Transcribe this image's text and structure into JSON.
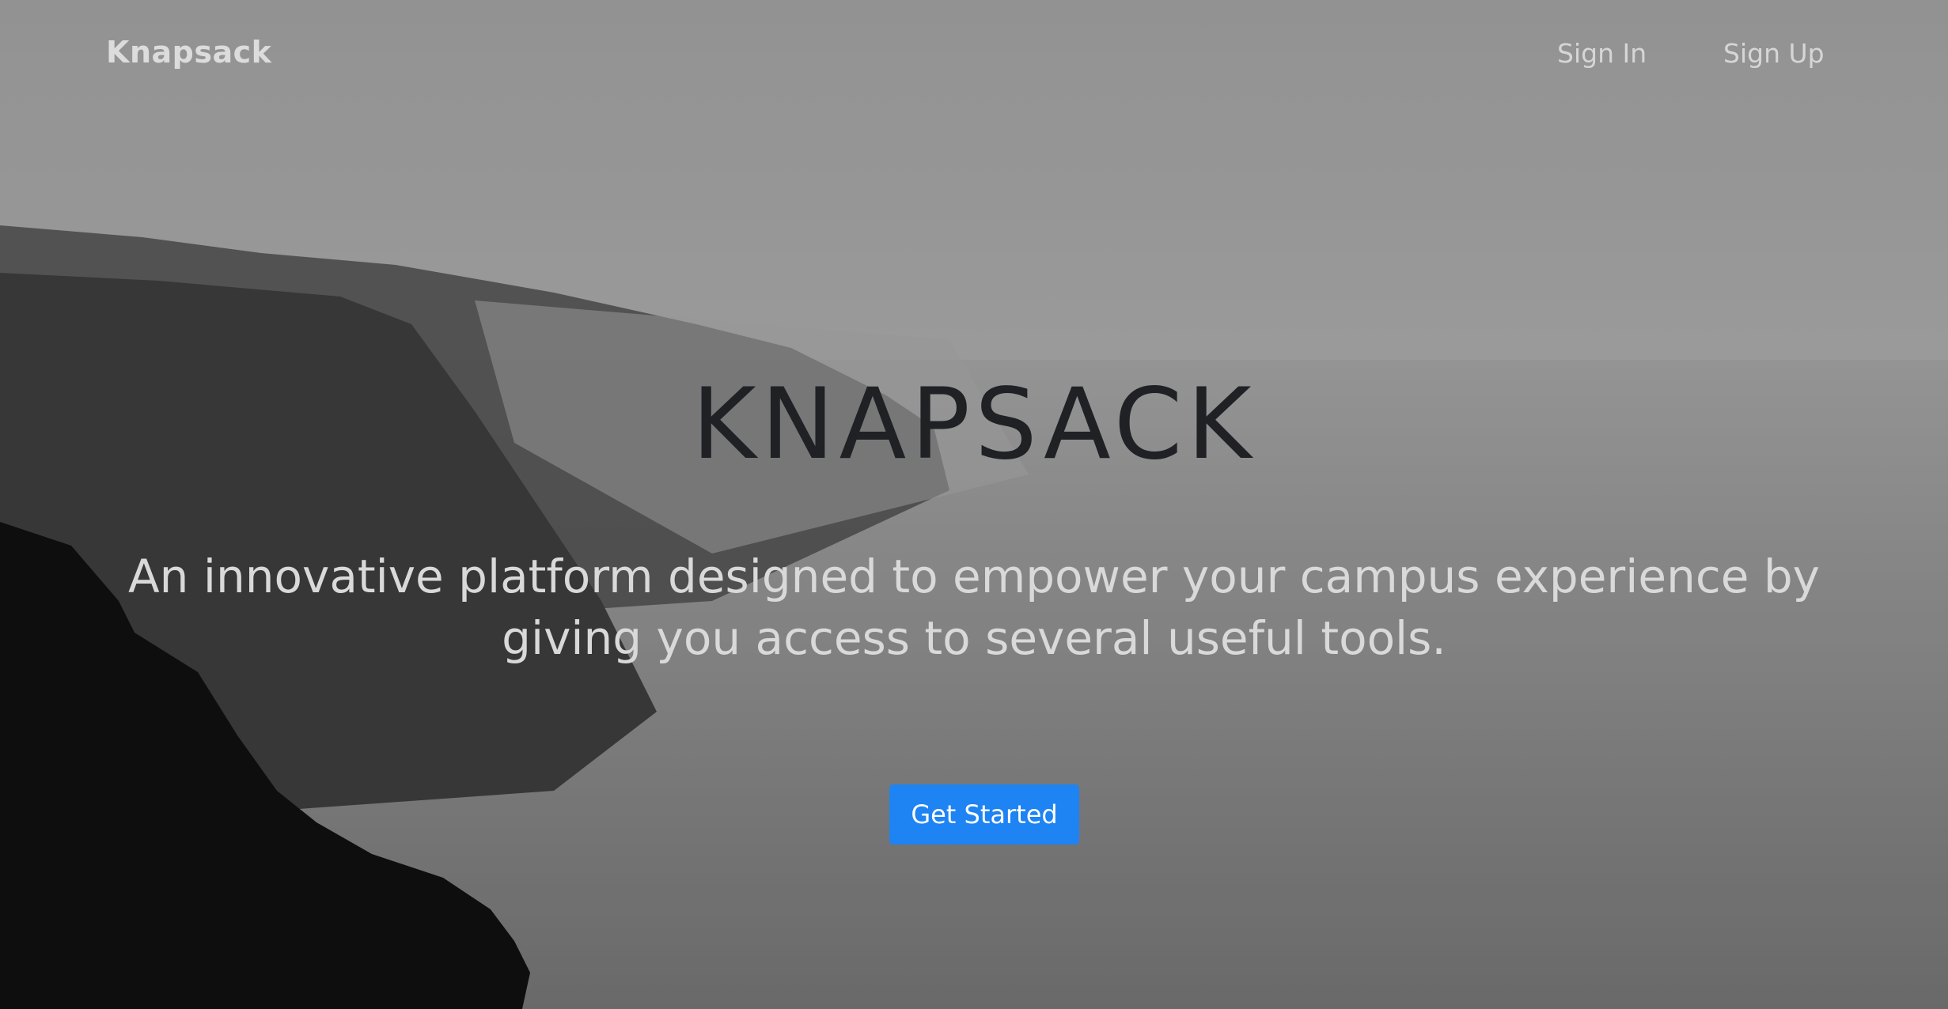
{
  "navbar": {
    "brand": "Knapsack",
    "links": [
      {
        "label": "Sign In"
      },
      {
        "label": "Sign Up"
      }
    ]
  },
  "hero": {
    "title": "KNAPSACK",
    "subtitle": "An innovative platform designed to empower your campus experience by giving you access to several useful tools.",
    "cta_label": "Get Started"
  },
  "colors": {
    "accent": "#1e83f3",
    "title_text": "#1f2125",
    "light_text": "#d9d9d9"
  },
  "background": {
    "image_icon": "foggy-cliffs-photo"
  }
}
